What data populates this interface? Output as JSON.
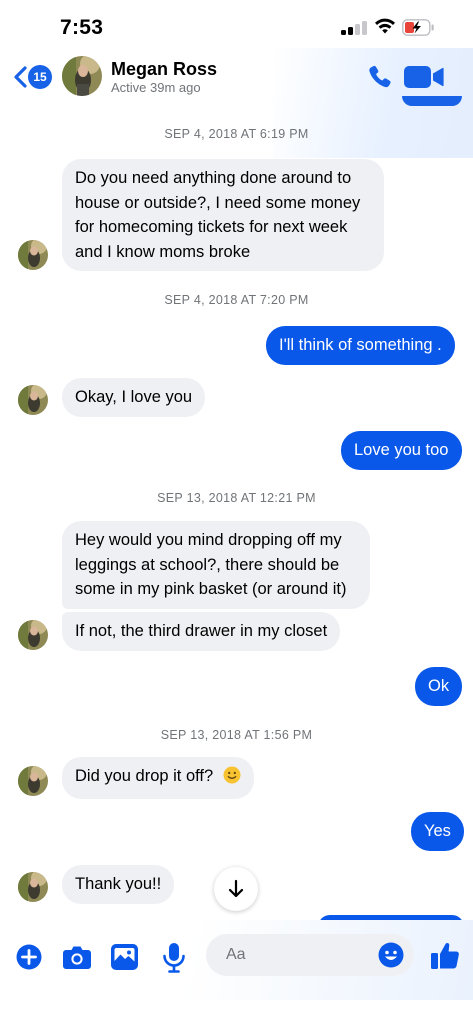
{
  "status_bar": {
    "time": "7:53"
  },
  "header": {
    "back_badge": "15",
    "contact_name": "Megan Ross",
    "contact_status": "Active 39m ago"
  },
  "messages": [
    {
      "type": "timestamp",
      "text": "SEP 4, 2018 AT 6:19 PM"
    },
    {
      "type": "in",
      "lines": [
        "Do you need anything done around to",
        "house or outside?, I need some money",
        "for homecoming tickets for next week",
        "and I know moms broke"
      ]
    },
    {
      "type": "timestamp",
      "text": "SEP 4, 2018 AT 7:20 PM"
    },
    {
      "type": "out",
      "text": "I'll think of something ."
    },
    {
      "type": "in",
      "text": "Okay, I love you"
    },
    {
      "type": "out",
      "text": "Love you too"
    },
    {
      "type": "timestamp",
      "text": "SEP 13, 2018 AT 12:21 PM"
    },
    {
      "type": "in",
      "lines": [
        "Hey would you mind dropping off my",
        "leggings at school?, there should be",
        "some in my pink basket (or around it)"
      ]
    },
    {
      "type": "in",
      "text": "If not, the third drawer in my closet"
    },
    {
      "type": "out",
      "text": "Ok"
    },
    {
      "type": "timestamp",
      "text": "SEP 13, 2018 AT 1:56 PM"
    },
    {
      "type": "in",
      "text": "Did you drop it off?"
    },
    {
      "type": "out",
      "text": "Yes"
    },
    {
      "type": "in",
      "text": "Thank you!!"
    }
  ],
  "composer": {
    "placeholder": "Aa"
  },
  "colors": {
    "accent": "#0a58e9",
    "incoming_bubble": "#eff0f4",
    "meta_text": "#707478"
  },
  "icons": [
    "plus-icon",
    "camera-icon",
    "photo-icon",
    "microphone-icon",
    "emoji-icon",
    "thumbs-up-icon",
    "arrow-down-icon",
    "phone-icon",
    "video-icon",
    "chevron-left-icon"
  ]
}
